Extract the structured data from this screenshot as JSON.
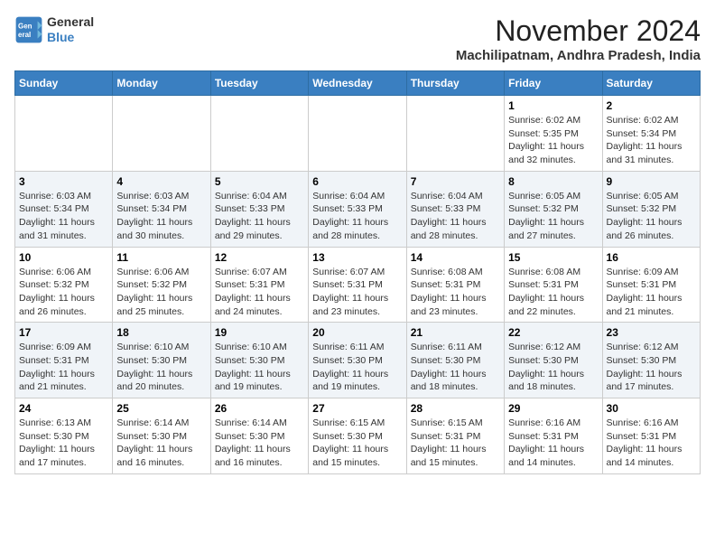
{
  "header": {
    "logo_line1": "General",
    "logo_line2": "Blue",
    "month_title": "November 2024",
    "location": "Machilipatnam, Andhra Pradesh, India"
  },
  "weekdays": [
    "Sunday",
    "Monday",
    "Tuesday",
    "Wednesday",
    "Thursday",
    "Friday",
    "Saturday"
  ],
  "weeks": [
    [
      {
        "day": "",
        "info": ""
      },
      {
        "day": "",
        "info": ""
      },
      {
        "day": "",
        "info": ""
      },
      {
        "day": "",
        "info": ""
      },
      {
        "day": "",
        "info": ""
      },
      {
        "day": "1",
        "info": "Sunrise: 6:02 AM\nSunset: 5:35 PM\nDaylight: 11 hours and 32 minutes."
      },
      {
        "day": "2",
        "info": "Sunrise: 6:02 AM\nSunset: 5:34 PM\nDaylight: 11 hours and 31 minutes."
      }
    ],
    [
      {
        "day": "3",
        "info": "Sunrise: 6:03 AM\nSunset: 5:34 PM\nDaylight: 11 hours and 31 minutes."
      },
      {
        "day": "4",
        "info": "Sunrise: 6:03 AM\nSunset: 5:34 PM\nDaylight: 11 hours and 30 minutes."
      },
      {
        "day": "5",
        "info": "Sunrise: 6:04 AM\nSunset: 5:33 PM\nDaylight: 11 hours and 29 minutes."
      },
      {
        "day": "6",
        "info": "Sunrise: 6:04 AM\nSunset: 5:33 PM\nDaylight: 11 hours and 28 minutes."
      },
      {
        "day": "7",
        "info": "Sunrise: 6:04 AM\nSunset: 5:33 PM\nDaylight: 11 hours and 28 minutes."
      },
      {
        "day": "8",
        "info": "Sunrise: 6:05 AM\nSunset: 5:32 PM\nDaylight: 11 hours and 27 minutes."
      },
      {
        "day": "9",
        "info": "Sunrise: 6:05 AM\nSunset: 5:32 PM\nDaylight: 11 hours and 26 minutes."
      }
    ],
    [
      {
        "day": "10",
        "info": "Sunrise: 6:06 AM\nSunset: 5:32 PM\nDaylight: 11 hours and 26 minutes."
      },
      {
        "day": "11",
        "info": "Sunrise: 6:06 AM\nSunset: 5:32 PM\nDaylight: 11 hours and 25 minutes."
      },
      {
        "day": "12",
        "info": "Sunrise: 6:07 AM\nSunset: 5:31 PM\nDaylight: 11 hours and 24 minutes."
      },
      {
        "day": "13",
        "info": "Sunrise: 6:07 AM\nSunset: 5:31 PM\nDaylight: 11 hours and 23 minutes."
      },
      {
        "day": "14",
        "info": "Sunrise: 6:08 AM\nSunset: 5:31 PM\nDaylight: 11 hours and 23 minutes."
      },
      {
        "day": "15",
        "info": "Sunrise: 6:08 AM\nSunset: 5:31 PM\nDaylight: 11 hours and 22 minutes."
      },
      {
        "day": "16",
        "info": "Sunrise: 6:09 AM\nSunset: 5:31 PM\nDaylight: 11 hours and 21 minutes."
      }
    ],
    [
      {
        "day": "17",
        "info": "Sunrise: 6:09 AM\nSunset: 5:31 PM\nDaylight: 11 hours and 21 minutes."
      },
      {
        "day": "18",
        "info": "Sunrise: 6:10 AM\nSunset: 5:30 PM\nDaylight: 11 hours and 20 minutes."
      },
      {
        "day": "19",
        "info": "Sunrise: 6:10 AM\nSunset: 5:30 PM\nDaylight: 11 hours and 19 minutes."
      },
      {
        "day": "20",
        "info": "Sunrise: 6:11 AM\nSunset: 5:30 PM\nDaylight: 11 hours and 19 minutes."
      },
      {
        "day": "21",
        "info": "Sunrise: 6:11 AM\nSunset: 5:30 PM\nDaylight: 11 hours and 18 minutes."
      },
      {
        "day": "22",
        "info": "Sunrise: 6:12 AM\nSunset: 5:30 PM\nDaylight: 11 hours and 18 minutes."
      },
      {
        "day": "23",
        "info": "Sunrise: 6:12 AM\nSunset: 5:30 PM\nDaylight: 11 hours and 17 minutes."
      }
    ],
    [
      {
        "day": "24",
        "info": "Sunrise: 6:13 AM\nSunset: 5:30 PM\nDaylight: 11 hours and 17 minutes."
      },
      {
        "day": "25",
        "info": "Sunrise: 6:14 AM\nSunset: 5:30 PM\nDaylight: 11 hours and 16 minutes."
      },
      {
        "day": "26",
        "info": "Sunrise: 6:14 AM\nSunset: 5:30 PM\nDaylight: 11 hours and 16 minutes."
      },
      {
        "day": "27",
        "info": "Sunrise: 6:15 AM\nSunset: 5:30 PM\nDaylight: 11 hours and 15 minutes."
      },
      {
        "day": "28",
        "info": "Sunrise: 6:15 AM\nSunset: 5:31 PM\nDaylight: 11 hours and 15 minutes."
      },
      {
        "day": "29",
        "info": "Sunrise: 6:16 AM\nSunset: 5:31 PM\nDaylight: 11 hours and 14 minutes."
      },
      {
        "day": "30",
        "info": "Sunrise: 6:16 AM\nSunset: 5:31 PM\nDaylight: 11 hours and 14 minutes."
      }
    ]
  ]
}
